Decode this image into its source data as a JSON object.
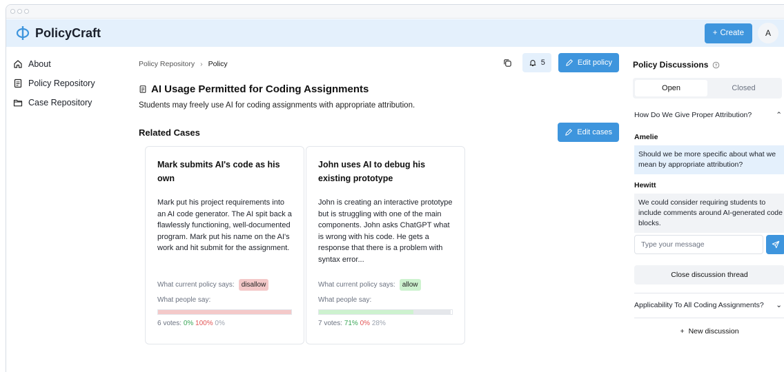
{
  "app": {
    "name": "PolicyCraft",
    "create_label": "Create",
    "avatar_initial": "A"
  },
  "sidebar": {
    "items": [
      {
        "label": "About",
        "icon": "home-icon"
      },
      {
        "label": "Policy Repository",
        "icon": "document-icon"
      },
      {
        "label": "Case Repository",
        "icon": "folder-icon"
      }
    ]
  },
  "breadcrumb": {
    "parent": "Policy Repository",
    "current": "Policy"
  },
  "actions": {
    "notifications_count": "5",
    "edit_policy_label": "Edit policy",
    "edit_cases_label": "Edit cases"
  },
  "policy": {
    "title": "AI Usage Permitted for Coding Assignments",
    "description": "Students may freely use AI for coding assignments with appropriate attribution."
  },
  "related_cases": {
    "heading": "Related Cases",
    "policy_says_label": "What current policy says:",
    "people_say_label": "What people say:",
    "cases": [
      {
        "title": "Mark submits AI's code as his own",
        "body": "Mark put his project requirements into an AI code generator. The AI spit back a flawlessly functioning, well-documented program. Mark put his name on the AI's work and hit submit for the assignment.",
        "policy": "disallow",
        "policy_color": "#f4c9c9",
        "votes_label": "6 votes:",
        "allow_pct": "0%",
        "disallow_pct": "100%",
        "neutral_pct": "0%",
        "allow_frac": 0.0,
        "disallow_frac": 1.0,
        "neutral_frac": 0.0
      },
      {
        "title": "John uses AI to debug his existing prototype",
        "body": "John is creating an interactive prototype but is struggling with one of the main components. John asks ChatGPT what is wrong with his code. He gets a response that there is a problem with syntax error...",
        "policy": "allow",
        "policy_color": "#cdf2cf",
        "votes_label": "7 votes:",
        "allow_pct": "71%",
        "disallow_pct": "0%",
        "neutral_pct": "28%",
        "allow_frac": 0.71,
        "disallow_frac": 0.0,
        "neutral_frac": 0.28
      }
    ]
  },
  "discussions": {
    "heading": "Policy Discussions",
    "tabs": [
      "Open",
      "Closed"
    ],
    "active_tab": "Open",
    "thread_title": "How Do We Give Proper Attribution?",
    "messages": [
      {
        "author": "Amelie",
        "text": "Should we be more specific about what we mean by appropriate attribution?"
      },
      {
        "author": "Hewitt",
        "text": "We could consider requiring students to include comments around AI-generated code blocks."
      }
    ],
    "input_placeholder": "Type your message",
    "close_label": "Close discussion thread",
    "second_thread_title": "Applicability To All Coding Assignments?",
    "new_label": "New discussion"
  },
  "colors": {
    "accent": "#3e95dd",
    "header_bg": "#e4f0fc",
    "allow": "#cdf2cf",
    "disallow": "#f4c9c9",
    "neutral": "#e5e7eb"
  }
}
